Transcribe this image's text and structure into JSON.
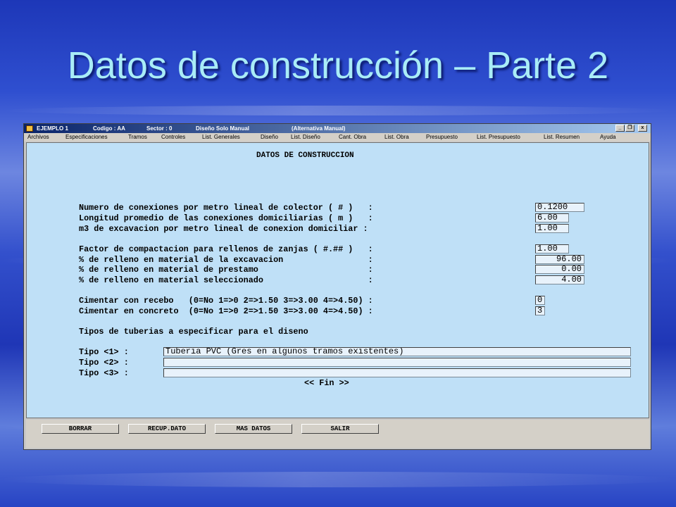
{
  "slide": {
    "title": "Datos de construcción – Parte 2"
  },
  "window": {
    "title_items": [
      "EJEMPLO 1",
      "Codigo : AA",
      "Sector : 0",
      "Diseño Solo Manual",
      "(Alternativa Manual)"
    ],
    "controls": [
      "_",
      "❐",
      "x"
    ]
  },
  "menu": [
    "Archivos",
    "Especificaciones",
    "Tramos",
    "Controles",
    "List. Generales",
    "Diseño",
    "List. Diseño",
    "Cant. Obra",
    "List. Obra",
    "Presupuesto",
    "List. Presupuesto",
    "List. Resumen",
    "Ayuda"
  ],
  "form": {
    "heading": "DATOS DE CONSTRUCCION",
    "fields": [
      {
        "label": "Numero de conexiones por metro lineal de colector ( # )   :",
        "value": "0.1200"
      },
      {
        "label": "Longitud promedio de las conexiones domiciliarias ( m )   :",
        "value": "6.00"
      },
      {
        "label": "m3 de excavacion por metro lineal de conexion domiciliar :",
        "value": "1.00"
      },
      {
        "label": "Factor de compactacion para rellenos de zanjas ( #.## )   :",
        "value": "1.00"
      },
      {
        "label": "% de relleno en material de la excavacion                 :",
        "value": "96.00"
      },
      {
        "label": "% de relleno en material de prestamo                      :",
        "value": "0.00"
      },
      {
        "label": "% de relleno en material seleccionado                     :",
        "value": "4.00"
      },
      {
        "label": "Cimentar con recebo   (0=No 1=>0 2=>1.50 3=>3.00 4=>4.50) :",
        "value": "0"
      },
      {
        "label": "Cimentar en concreto  (0=No 1=>0 2=>1.50 3=>3.00 4=>4.50) :",
        "value": "3"
      }
    ],
    "tipos_heading": "Tipos de tuberias a especificar para el diseno",
    "tipos": [
      {
        "label": "Tipo <1> :",
        "value": "Tuberia PVC (Gres en algunos tramos existentes)"
      },
      {
        "label": "Tipo <2> :",
        "value": ""
      },
      {
        "label": "Tipo <3> :",
        "value": ""
      }
    ],
    "fin": "<< Fin >>"
  },
  "buttons": [
    "BORRAR",
    "RECUP.DATO",
    "MAS DATOS",
    "SALIR"
  ]
}
